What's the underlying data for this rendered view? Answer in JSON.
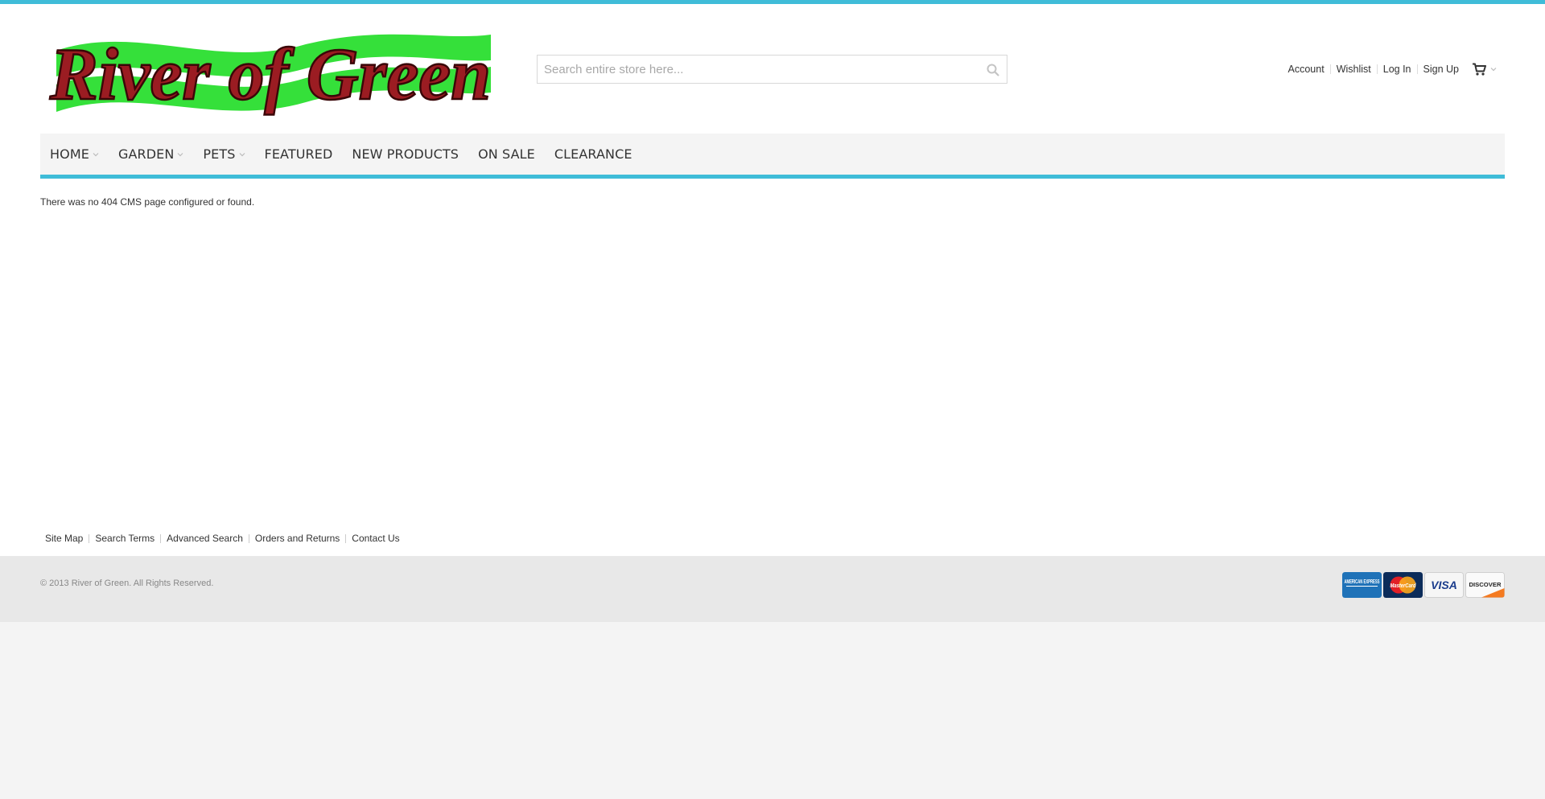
{
  "brand": {
    "name": "River of Green",
    "logo_text": "River of Green"
  },
  "search": {
    "placeholder": "Search entire store here..."
  },
  "toplinks": {
    "account": "Account",
    "wishlist": "Wishlist",
    "login": "Log In",
    "signup": "Sign Up"
  },
  "nav": {
    "items": [
      {
        "label": "HOME",
        "has_dropdown": true
      },
      {
        "label": "GARDEN",
        "has_dropdown": true
      },
      {
        "label": "PETS",
        "has_dropdown": true
      },
      {
        "label": "FEATURED",
        "has_dropdown": false
      },
      {
        "label": "NEW PRODUCTS",
        "has_dropdown": false
      },
      {
        "label": "ON SALE",
        "has_dropdown": false
      },
      {
        "label": "CLEARANCE",
        "has_dropdown": false
      }
    ]
  },
  "main": {
    "message": "There was no 404 CMS page configured or found."
  },
  "footer": {
    "links": [
      "Site Map",
      "Search Terms",
      "Advanced Search",
      "Orders and Returns",
      "Contact Us"
    ],
    "copyright": "© 2013 River of Green. All Rights Reserved.",
    "payment_cards": [
      "AMERICAN EXPRESS",
      "MasterCard",
      "VISA",
      "DISCOVER"
    ]
  },
  "colors": {
    "accent": "#3fbcd8",
    "logo_red": "#9b1c22",
    "logo_green": "#35e03a",
    "nav_bg": "#f4f4f4",
    "footer_bg": "#e8e8e8"
  },
  "icons": {
    "search": "search-icon",
    "cart": "cart-icon",
    "chevron": "chevron-down-icon"
  }
}
